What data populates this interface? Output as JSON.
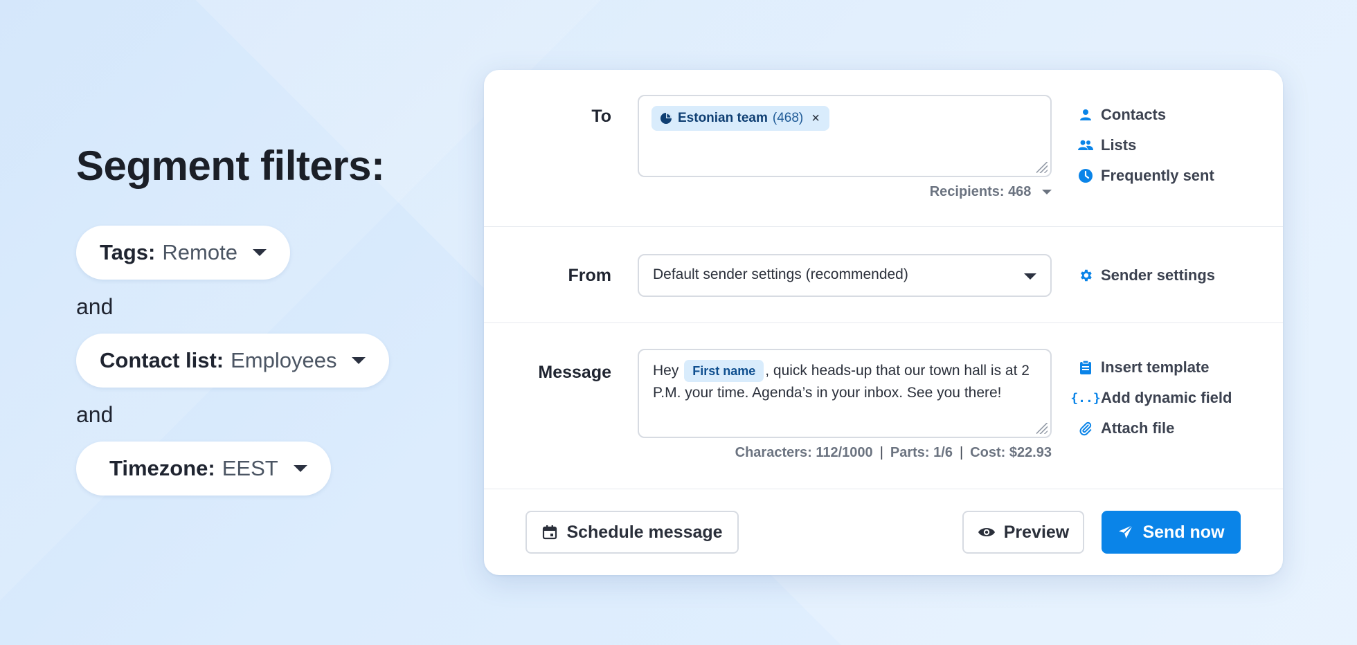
{
  "left": {
    "title": "Segment filters:",
    "filters": [
      {
        "key": "Tags:",
        "value": "Remote"
      },
      {
        "key": "Contact list:",
        "value": "Employees"
      },
      {
        "key": "Timezone:",
        "value": "EEST"
      }
    ],
    "connector": "and"
  },
  "to": {
    "label": "To",
    "chip": {
      "name": "Estonian team",
      "count": "(468)",
      "remove": "×"
    },
    "recipients": "Recipients: 468",
    "side": [
      "Contacts",
      "Lists",
      "Frequently sent"
    ]
  },
  "from": {
    "label": "From",
    "selected": "Default sender settings (recommended)",
    "side": "Sender settings"
  },
  "message": {
    "label": "Message",
    "prefix": "Hey",
    "dynamic_field": "First name",
    "suffix": ", quick heads-up that our town hall is at 2 P.M. your time. Agenda’s in your inbox. See you there!",
    "characters": "Characters: 112/1000",
    "parts": "Parts: 1/6",
    "cost": "Cost: $22.93",
    "side": [
      "Insert template",
      "Add dynamic field",
      "Attach file"
    ]
  },
  "actions": {
    "schedule": "Schedule message",
    "preview": "Preview",
    "send": "Send now"
  },
  "colors": {
    "accent": "#0a84e8",
    "chip_bg": "#d9ecfc",
    "text_dark": "#1f2430"
  }
}
